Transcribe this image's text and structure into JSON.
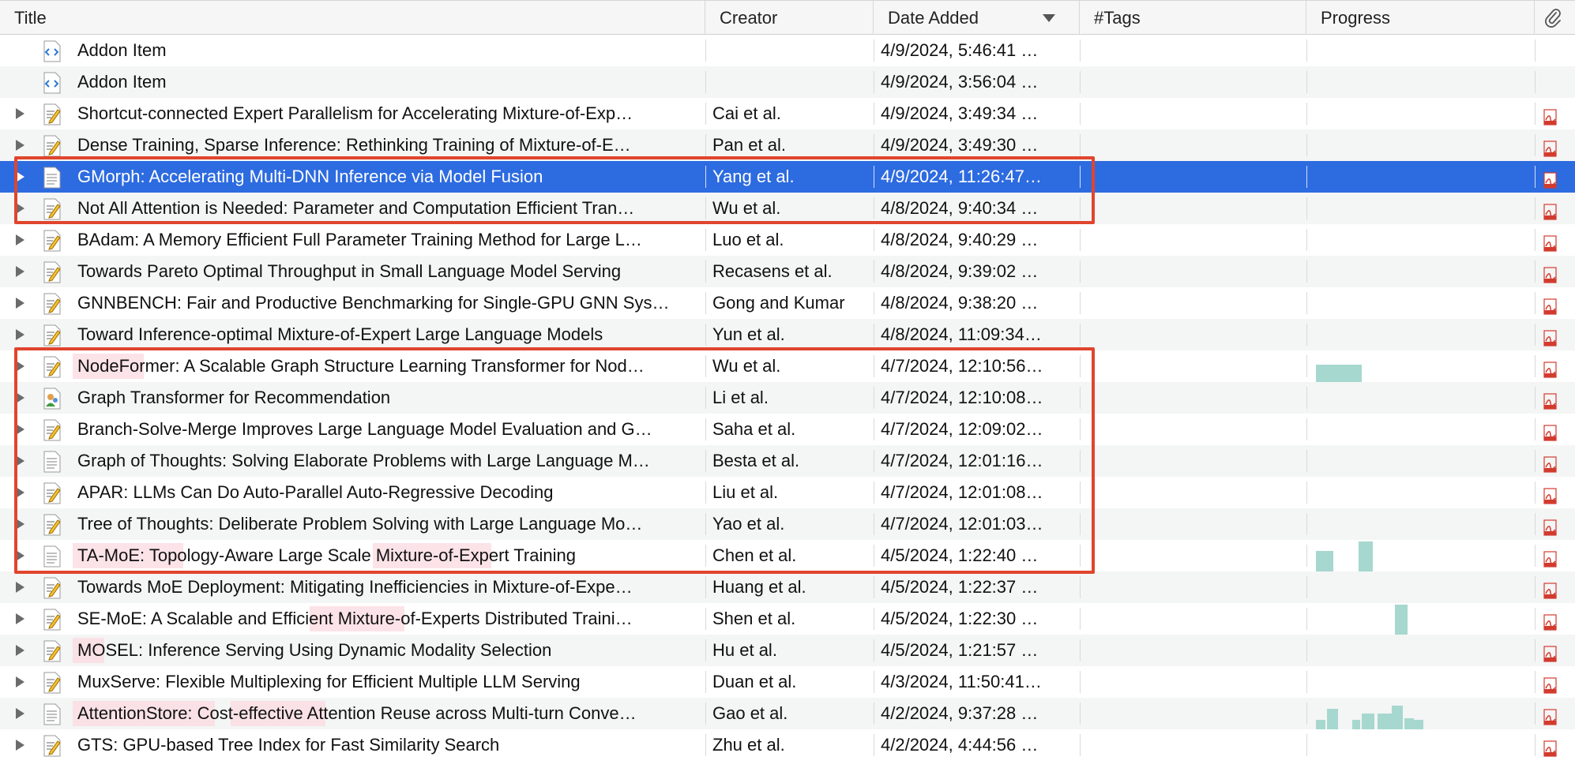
{
  "columns": {
    "title": "Title",
    "creator": "Creator",
    "date_added": "Date Added",
    "tags": "#Tags",
    "progress": "Progress",
    "attachment_icon": "paperclip-icon"
  },
  "sort": {
    "column": "date_added",
    "direction": "descending"
  },
  "colors": {
    "selection": "#2d6be0",
    "highlight_box": "#e0452d",
    "progress_spark": "#a6d8cf",
    "title_highlight": "#fbd9e0"
  },
  "items": [
    {
      "type": "addon",
      "expandable": false,
      "title": "Addon Item",
      "creator": "",
      "date": "4/9/2024, 5:46:41 …",
      "pdf": false
    },
    {
      "type": "addon",
      "expandable": false,
      "title": "Addon Item",
      "creator": "",
      "date": "4/9/2024, 3:56:04 …",
      "pdf": false
    },
    {
      "type": "preprint",
      "expandable": true,
      "title": "Shortcut-connected Expert Parallelism for Accelerating Mixture-of-Exp…",
      "creator": "Cai et al.",
      "date": "4/9/2024, 3:49:34 …",
      "pdf": true
    },
    {
      "type": "preprint",
      "expandable": true,
      "title": "Dense Training, Sparse Inference: Rethinking Training of Mixture-of-E…",
      "creator": "Pan et al.",
      "date": "4/9/2024, 3:49:30 …",
      "pdf": true
    },
    {
      "type": "document",
      "expandable": true,
      "selected": true,
      "title": "GMorph: Accelerating Multi-DNN Inference via Model Fusion",
      "creator": "Yang et al.",
      "date": "4/9/2024, 11:26:47…",
      "pdf": true
    },
    {
      "type": "preprint",
      "expandable": true,
      "title": "Not All Attention is Needed: Parameter and Computation Efficient Tran…",
      "creator": "Wu et al.",
      "date": "4/8/2024, 9:40:34 …",
      "pdf": true
    },
    {
      "type": "preprint",
      "expandable": true,
      "title": "BAdam: A Memory Efficient Full Parameter Training Method for Large L…",
      "creator": "Luo et al.",
      "date": "4/8/2024, 9:40:29 …",
      "pdf": true
    },
    {
      "type": "preprint",
      "expandable": true,
      "title": "Towards Pareto Optimal Throughput in Small Language Model Serving",
      "creator": "Recasens et al.",
      "date": "4/8/2024, 9:39:02 …",
      "pdf": true
    },
    {
      "type": "preprint",
      "expandable": true,
      "title": "GNNBENCH: Fair and Productive Benchmarking for Single-GPU GNN Sys…",
      "creator": "Gong and Kumar",
      "date": "4/8/2024, 9:38:20 …",
      "pdf": true
    },
    {
      "type": "preprint",
      "expandable": true,
      "title": "Toward Inference-optimal Mixture-of-Expert Large Language Models",
      "creator": "Yun et al.",
      "date": "4/8/2024, 11:09:34…",
      "pdf": true
    },
    {
      "type": "preprint",
      "expandable": true,
      "title": "NodeFormer: A Scalable Graph Structure Learning Transformer for Nod…",
      "creator": "Wu et al.",
      "date": "4/7/2024, 12:10:56…",
      "pdf": true
    },
    {
      "type": "presentation",
      "expandable": true,
      "title": "Graph Transformer for Recommendation",
      "creator": "Li et al.",
      "date": "4/7/2024, 12:10:08…",
      "pdf": true
    },
    {
      "type": "preprint",
      "expandable": true,
      "title": "Branch-Solve-Merge Improves Large Language Model Evaluation and G…",
      "creator": "Saha et al.",
      "date": "4/7/2024, 12:09:02…",
      "pdf": true
    },
    {
      "type": "document",
      "expandable": true,
      "title": "Graph of Thoughts: Solving Elaborate Problems with Large Language M…",
      "creator": "Besta et al.",
      "date": "4/7/2024, 12:01:16…",
      "pdf": true
    },
    {
      "type": "preprint",
      "expandable": true,
      "title": "APAR: LLMs Can Do Auto-Parallel Auto-Regressive Decoding",
      "creator": "Liu et al.",
      "date": "4/7/2024, 12:01:08…",
      "pdf": true
    },
    {
      "type": "preprint",
      "expandable": true,
      "title": "Tree of Thoughts: Deliberate Problem Solving with Large Language Mo…",
      "creator": "Yao et al.",
      "date": "4/7/2024, 12:01:03…",
      "pdf": true
    },
    {
      "type": "document",
      "expandable": true,
      "title": "TA-MoE: Topology-Aware Large Scale Mixture-of-Expert Training",
      "creator": "Chen et al.",
      "date": "4/5/2024, 1:22:40 …",
      "pdf": true
    },
    {
      "type": "preprint",
      "expandable": true,
      "title": "Towards MoE Deployment: Mitigating Inefficiencies in Mixture-of-Expe…",
      "creator": "Huang et al.",
      "date": "4/5/2024, 1:22:37 …",
      "pdf": true
    },
    {
      "type": "preprint",
      "expandable": true,
      "title": "SE-MoE: A Scalable and Efficient Mixture-of-Experts Distributed Traini…",
      "creator": "Shen et al.",
      "date": "4/5/2024, 1:22:30 …",
      "pdf": true
    },
    {
      "type": "preprint",
      "expandable": true,
      "title": "MOSEL: Inference Serving Using Dynamic Modality Selection",
      "creator": "Hu et al.",
      "date": "4/5/2024, 1:21:57 …",
      "pdf": true
    },
    {
      "type": "preprint",
      "expandable": true,
      "title": "MuxServe: Flexible Multiplexing for Efficient Multiple LLM Serving",
      "creator": "Duan et al.",
      "date": "4/3/2024, 11:50:41…",
      "pdf": true
    },
    {
      "type": "document",
      "expandable": true,
      "title": "AttentionStore: Cost-effective Attention Reuse across Multi-turn Conve…",
      "creator": "Gao et al.",
      "date": "4/2/2024, 9:37:28 …",
      "pdf": true
    },
    {
      "type": "preprint",
      "expandable": true,
      "title": "GTS: GPU-based Tree Index for Fast Similarity Search",
      "creator": "Zhu et al.",
      "date": "4/2/2024, 4:44:56 …",
      "pdf": true
    }
  ]
}
